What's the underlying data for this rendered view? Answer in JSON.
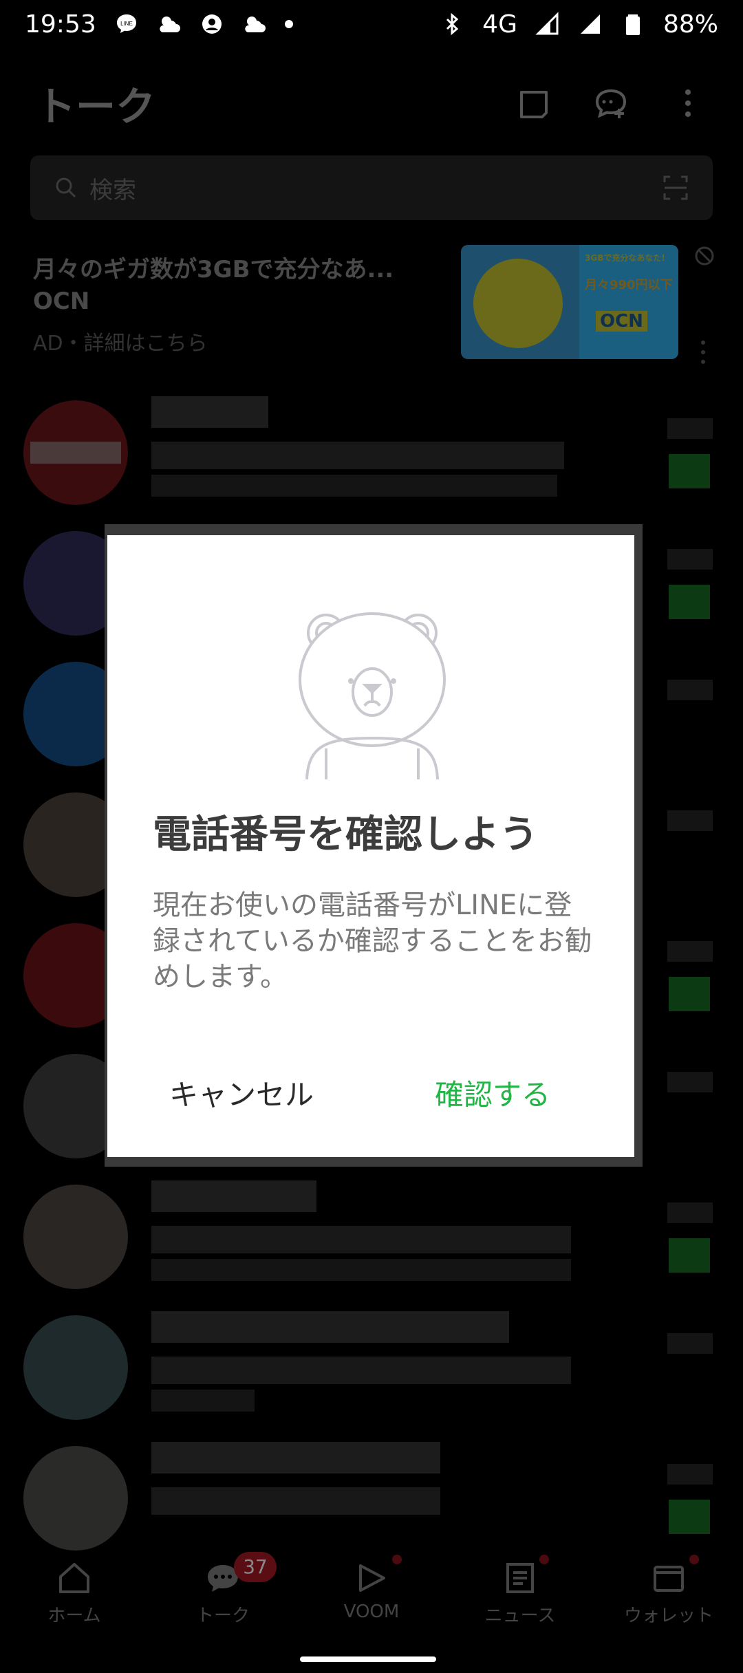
{
  "status_bar": {
    "time": "19:53",
    "network": "4G",
    "battery": "88%"
  },
  "header": {
    "title": "トーク"
  },
  "search": {
    "placeholder": "検索"
  },
  "ad": {
    "headline": "月々のギガ数が3GBで充分なあ...",
    "advertiser": "OCN",
    "meta": "AD・詳細はこちら",
    "banner_line1": "3GBで充分なあなた!",
    "banner_price": "月々990円以下",
    "banner_brand": "OCN"
  },
  "dialog": {
    "title": "電話番号を確認しよう",
    "body": "現在お使いの電話番号がLINEに登録されているか確認することをお勧めします。",
    "cancel_label": "キャンセル",
    "confirm_label": "確認する"
  },
  "bottom_nav": {
    "items": [
      {
        "label": "ホーム",
        "icon": "home-icon"
      },
      {
        "label": "トーク",
        "icon": "chat-icon",
        "badge": "37"
      },
      {
        "label": "VOOM",
        "icon": "voom-icon"
      },
      {
        "label": "ニュース",
        "icon": "news-icon"
      },
      {
        "label": "ウォレット",
        "icon": "wallet-icon"
      }
    ]
  },
  "colors": {
    "accent_green": "#22b546",
    "badge_red": "#e8323c",
    "dialog_bg": "#ffffff",
    "screen_bg": "#000000"
  }
}
